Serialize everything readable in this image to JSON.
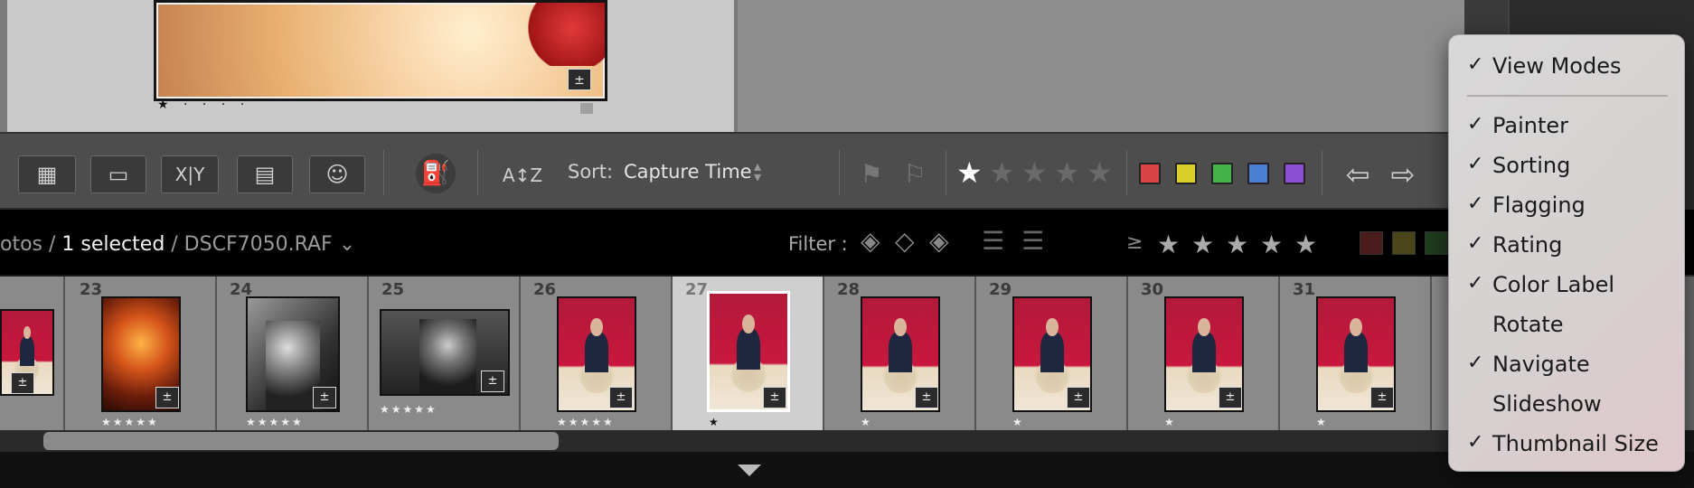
{
  "grid": {
    "photos": [
      {
        "rating": "★ · · · ·",
        "badge": "±"
      },
      {
        "rating": "★ · · · ·",
        "badge": "±"
      }
    ]
  },
  "toolbar": {
    "view_modes": [
      {
        "name": "grid-view",
        "glyph": "▦"
      },
      {
        "name": "loupe-view",
        "glyph": "▭"
      },
      {
        "name": "compare-view",
        "glyph": "X|Y"
      },
      {
        "name": "survey-view",
        "glyph": "▤"
      },
      {
        "name": "people-view",
        "glyph": "☺"
      }
    ],
    "painter_glyph": "⛽",
    "sort_icon": "A↕Z",
    "sort_label": "Sort:",
    "sort_value": "Capture Time",
    "flags": [
      "⚑",
      "⚐"
    ],
    "prev_glyph": "⇦",
    "next_glyph": "⇨",
    "color_labels": [
      "#d94545",
      "#d9cf2a",
      "#45b34a",
      "#4a7fd4",
      "#8a4fd4"
    ]
  },
  "filterbar": {
    "path_prefix": "otos /",
    "selected": "1 selected",
    "path_suffix": "/ DSCF7050.RAF",
    "dropdown": "⌄",
    "filter_label": "Filter :",
    "rating_operator": "≥"
  },
  "filmstrip": {
    "cells": [
      {
        "num": "",
        "stars": ""
      },
      {
        "num": "23",
        "stars": "★★★★★"
      },
      {
        "num": "24",
        "stars": "★★★★★"
      },
      {
        "num": "25",
        "stars": "★★★★★"
      },
      {
        "num": "26",
        "stars": "★★★★★"
      },
      {
        "num": "27",
        "stars": "★"
      },
      {
        "num": "28",
        "stars": "★"
      },
      {
        "num": "29",
        "stars": "★"
      },
      {
        "num": "30",
        "stars": "★"
      },
      {
        "num": "31",
        "stars": "★"
      }
    ]
  },
  "menu": {
    "items": [
      {
        "label": "View Modes",
        "checked": "✓"
      },
      {
        "label": "Painter",
        "checked": "✓"
      },
      {
        "label": "Sorting",
        "checked": "✓"
      },
      {
        "label": "Flagging",
        "checked": "✓"
      },
      {
        "label": "Rating",
        "checked": "✓"
      },
      {
        "label": "Color Label",
        "checked": "✓"
      },
      {
        "label": "Rotate",
        "checked": ""
      },
      {
        "label": "Navigate",
        "checked": "✓"
      },
      {
        "label": "Slideshow",
        "checked": ""
      },
      {
        "label": "Thumbnail Size",
        "checked": "✓"
      }
    ]
  }
}
